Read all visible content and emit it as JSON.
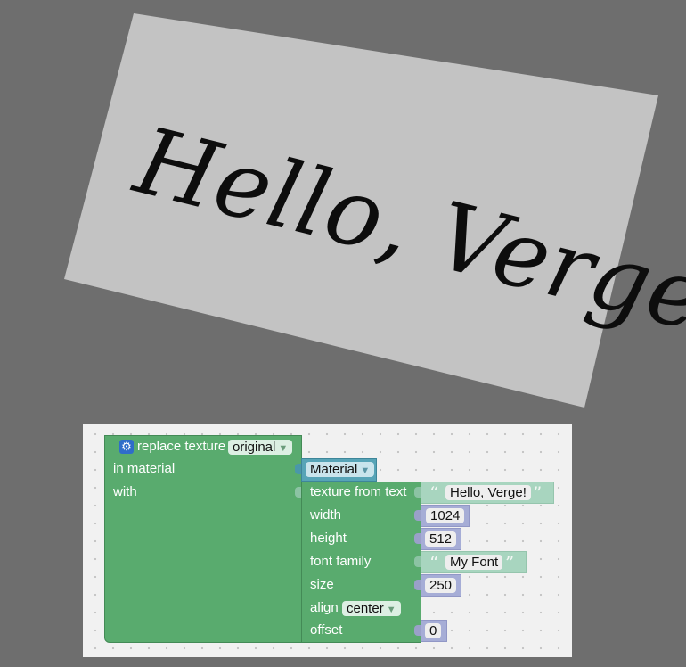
{
  "scene": {
    "text": "Hello, Verge!",
    "card_color": "#c3c3c3",
    "background_color": "#6e6e6e"
  },
  "blocks": {
    "replace_label": "replace texture",
    "replace_dropdown": "original",
    "in_material_label": "in material",
    "with_label": "with",
    "material_dropdown": "Material",
    "texture_from_text_label": "texture from text",
    "text_value": "Hello, Verge!",
    "width_label": "width",
    "width_value": "1024",
    "height_label": "height",
    "height_value": "512",
    "font_family_label": "font family",
    "font_family_value": "My Font",
    "size_label": "size",
    "size_value": "250",
    "align_label": "align",
    "align_dropdown": "center",
    "offset_label": "offset",
    "offset_value": "0",
    "dropdown_arrow": "▼",
    "open_quote": "“",
    "close_quote": "”",
    "gear_icon": "gear-icon"
  }
}
